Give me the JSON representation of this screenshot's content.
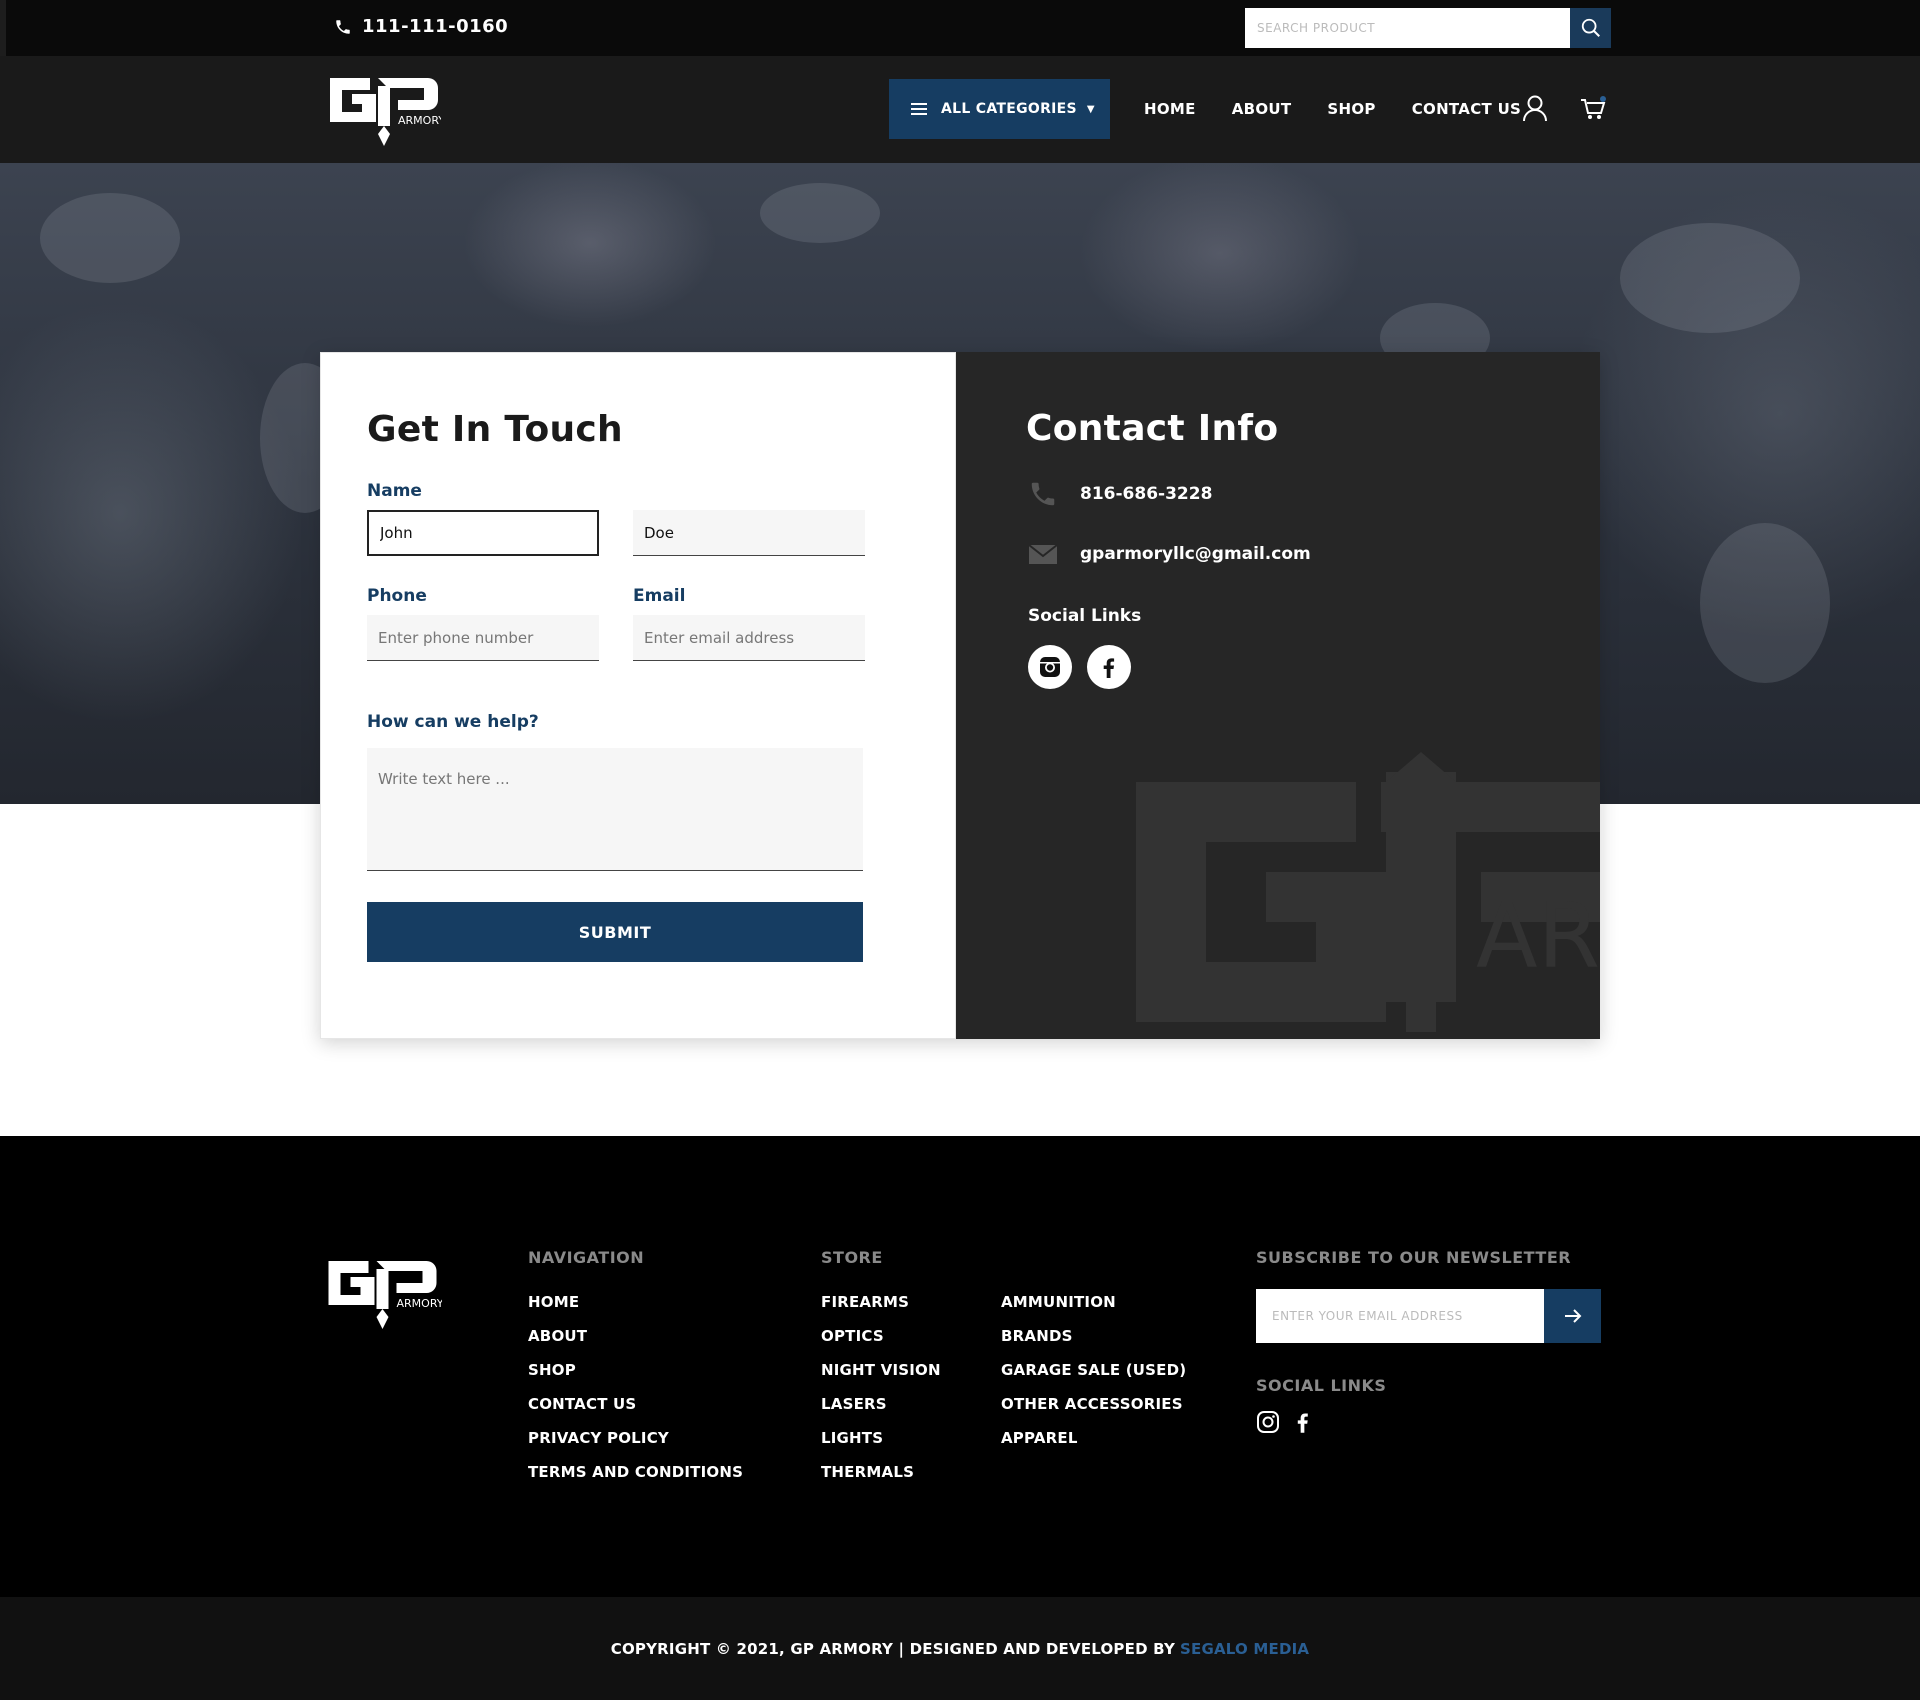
{
  "topbar": {
    "phone": "111-111-0160",
    "search_placeholder": "SEARCH PRODUCT"
  },
  "header": {
    "logo_text": "GP ARMORY",
    "categories_label": "ALL CATEGORIES",
    "nav": [
      "HOME",
      "ABOUT",
      "SHOP",
      "CONTACT US"
    ]
  },
  "form": {
    "title": "Get In Touch",
    "name_label": "Name",
    "first_name_value": "John",
    "last_name_value": "Doe",
    "phone_label": "Phone",
    "phone_placeholder": "Enter phone number",
    "email_label": "Email",
    "email_placeholder": "Enter email address",
    "help_label": "How can we help?",
    "help_placeholder": "Write text here ...",
    "submit_label": "SUBMIT"
  },
  "contact_info": {
    "title": "Contact Info",
    "phone": "816-686-3228",
    "email": "gparmoryllc@gmail.com",
    "social_title": "Social Links"
  },
  "footer": {
    "navigation_title": "NAVIGATION",
    "navigation": [
      "HOME",
      "ABOUT",
      "SHOP",
      "CONTACT US",
      "PRIVACY POLICY",
      "TERMS AND CONDITIONS"
    ],
    "store_title": "STORE",
    "store_col1": [
      "FIREARMS",
      "OPTICS",
      "NIGHT VISION",
      "LASERS",
      "LIGHTS",
      "THERMALS"
    ],
    "store_col2": [
      "AMMUNITION",
      "BRANDS",
      "GARAGE SALE (USED)",
      "OTHER ACCESSORIES",
      "APPAREL"
    ],
    "newsletter_title": "SUBSCRIBE TO OUR NEWSLETTER",
    "newsletter_placeholder": "ENTER YOUR EMAIL ADDRESS",
    "social_title": "SOCIAL LINKS",
    "copyright": "COPYRIGHT © 2021, GP ARMORY | DESIGNED AND DEVELOPED BY",
    "credit": "SEGALO MEDIA"
  },
  "colors": {
    "brand_blue": "#163d62",
    "dark_panel": "#262626",
    "link_blue": "#2a5f94"
  }
}
